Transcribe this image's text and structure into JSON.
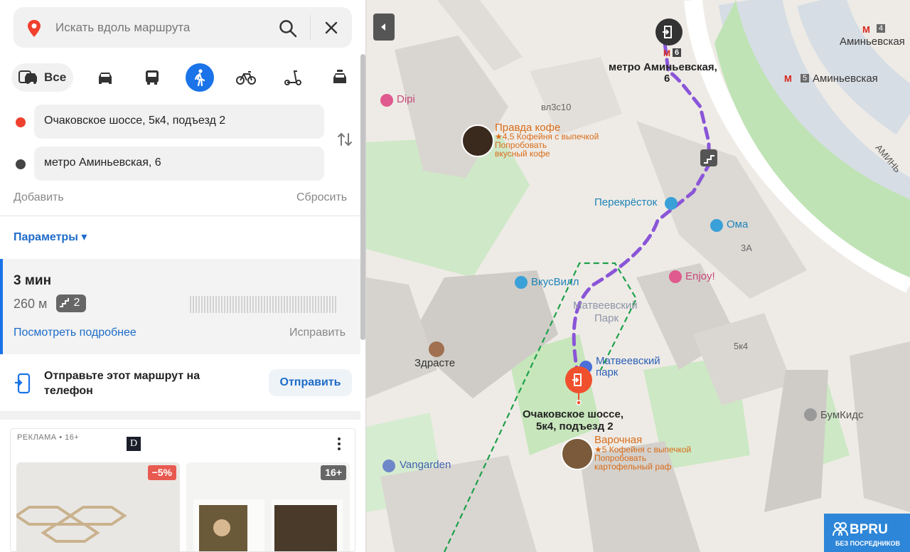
{
  "search": {
    "placeholder": "Искать вдоль маршрута"
  },
  "modes": {
    "all_label": "Все"
  },
  "route_points": {
    "from": "Очаковское шоссе, 5к4, подъезд 2",
    "to": "метро Аминьевская, 6",
    "add_label": "Добавить",
    "reset_label": "Сбросить"
  },
  "params_label": "Параметры ▾",
  "route": {
    "time": "3 мин",
    "distance": "260 м",
    "stairs_count": "2",
    "details_label": "Посмотреть подробнее",
    "fix_label": "Исправить"
  },
  "send": {
    "text": "Отправьте этот маршрут на телефон",
    "button_label": "Отправить"
  },
  "ad": {
    "label": "РЕКЛАМА • 16+",
    "logo": "D",
    "badge1": "−5%",
    "badge2": "16+"
  },
  "map": {
    "labels": {
      "metro_top": "4",
      "aminyevskaya1": "Аминьевская",
      "metro_mid": "5",
      "aminyevskaya2": "Аминьевская",
      "aminyevskaya_road": "АМИНЬ",
      "exit_metro_num": "6",
      "destination": "метро Аминьевская,",
      "destination2": "6",
      "dipi": "Dipi",
      "vl3s10": "вл3с10",
      "pravda_name": "Правда кофе",
      "pravda_sub1": "★4,5 Кофейня с выпечкой",
      "pravda_sub2": "Попробовать",
      "pravda_sub3": "вкусный кофе",
      "perekrestok": "Перекрёсток",
      "oma": "Ома",
      "3a": "3А",
      "enjoy": "Enjoy!",
      "vkusvill": "ВкусВилл",
      "matv_park": "Матвеевский",
      "matv_park2": "Парк",
      "matv_park_blue": "Матвеевский",
      "matv_park_blue2": "парк",
      "5k4": "5к4",
      "zdraste": "Здрасте",
      "start": "Очаковское шоссе,",
      "start2": "5к4, подъезд 2",
      "varochnaya": "Варочная",
      "var_sub1": "★5 Кофейня с выпечкой",
      "var_sub2": "Попробовать",
      "var_sub3": "картофельный раф",
      "bumkids": "БумКидс",
      "vangarden": "Vangarden"
    },
    "watermark": {
      "big": "BPRU",
      "small": "БЕЗ ПОСРЕДНИКОВ"
    },
    "colors": {
      "route": "#8a55d8",
      "accent": "#1a73e8",
      "start_pin": "#f0502e",
      "park": "#c8e6c0"
    }
  }
}
